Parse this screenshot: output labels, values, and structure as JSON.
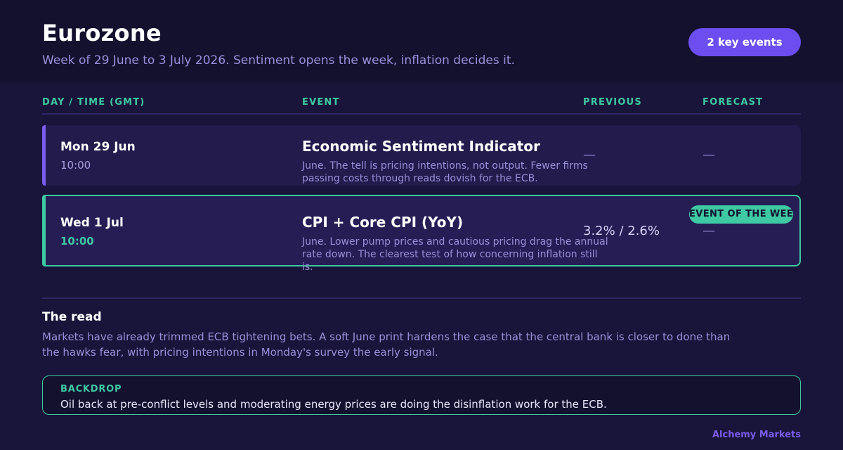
{
  "header": {
    "title": "Eurozone",
    "subtitle": "Week of 29 June to 3 July 2026. Sentiment opens the week, inflation decides it.",
    "events_pill": "2 key events"
  },
  "table": {
    "columns": [
      "DAY / TIME (GMT)",
      "EVENT",
      "PREVIOUS",
      "FORECAST"
    ],
    "rows": [
      {
        "day": "Mon 29 Jun",
        "time": "10:00",
        "event": "Economic Sentiment Indicator",
        "description": "June. The tell is pricing intentions, not output. Fewer firms passing costs through reads dovish for the ECB.",
        "previous": "—",
        "forecast": "—"
      },
      {
        "day": "Wed 1 Jul",
        "time": "10:00",
        "event": "CPI + Core CPI (YoY)",
        "description": "June. Lower pump prices and cautious pricing drag the annual rate down. The clearest test of how concerning inflation still is.",
        "previous": "3.2% / 2.6%",
        "forecast": "—",
        "badge": "EVENT OF THE WEEK"
      }
    ]
  },
  "read": {
    "heading": "The read",
    "body": "Markets have already trimmed ECB tightening bets. A soft June print hardens the case that the central bank is closer to done than the hawks fear, with pricing intentions in Monday's survey the early signal."
  },
  "backdrop": {
    "label": "BACKDROP",
    "text": "Oil back at pre-conflict levels and moderating energy prices are doing the disinflation work for the ECB."
  },
  "footer": {
    "brand": "Alchemy Markets"
  },
  "colors": {
    "accent_purple": "#6c4ef0",
    "accent_green": "#3ec9a2",
    "background": "#14112f"
  }
}
